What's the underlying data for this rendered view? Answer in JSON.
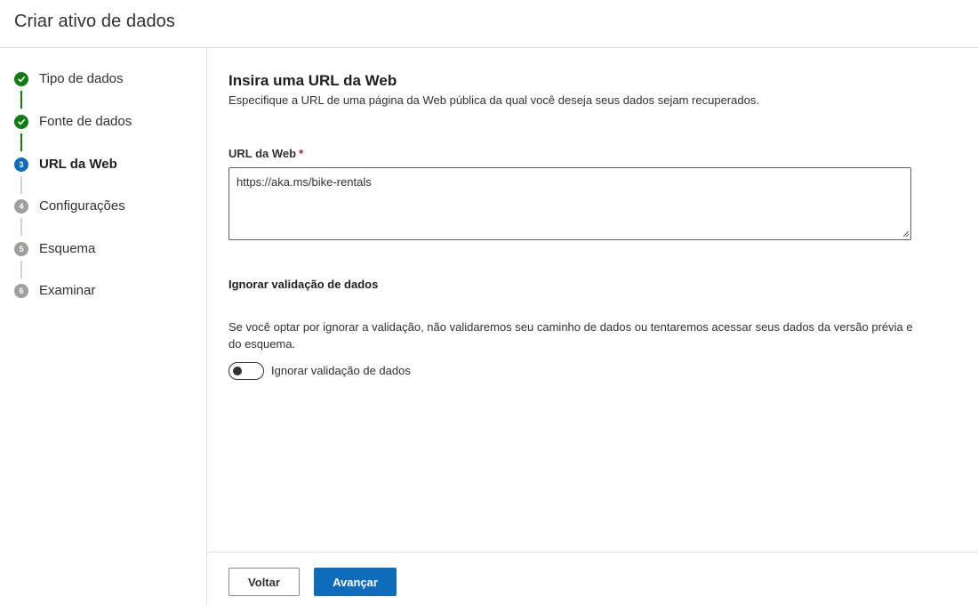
{
  "header": {
    "title": "Criar ativo de dados"
  },
  "steps": [
    {
      "number": "1",
      "label": "Tipo de dados",
      "status": "done",
      "icon": "check-icon"
    },
    {
      "number": "2",
      "label": "Fonte de dados",
      "status": "done",
      "icon": "check-icon"
    },
    {
      "number": "3",
      "label": "URL da Web",
      "status": "current"
    },
    {
      "number": "4",
      "label": "Configurações",
      "status": "todo"
    },
    {
      "number": "5",
      "label": "Esquema",
      "status": "todo"
    },
    {
      "number": "6",
      "label": "Examinar",
      "status": "todo"
    }
  ],
  "main": {
    "title": "Insira uma URL da Web",
    "description": "Especifique a URL de uma página da Web pública da qual você deseja seus dados sejam recuperados.",
    "url_field": {
      "label": "URL da Web",
      "required_mark": "*",
      "value": "https://aka.ms/bike-rentals"
    },
    "skip_validation": {
      "heading": "Ignorar validação de dados",
      "text": "Se você optar por ignorar a validação, não validaremos seu caminho de dados ou tentaremos acessar seus dados da versão prévia e do esquema.",
      "toggle_label": "Ignorar validação de dados",
      "toggle_on": false
    }
  },
  "footer": {
    "back_label": "Voltar",
    "next_label": "Avançar"
  },
  "colors": {
    "done": "#107c10",
    "current": "#0f6cbd",
    "todo": "#a19f9d",
    "primary_button": "#0f6cbd"
  }
}
